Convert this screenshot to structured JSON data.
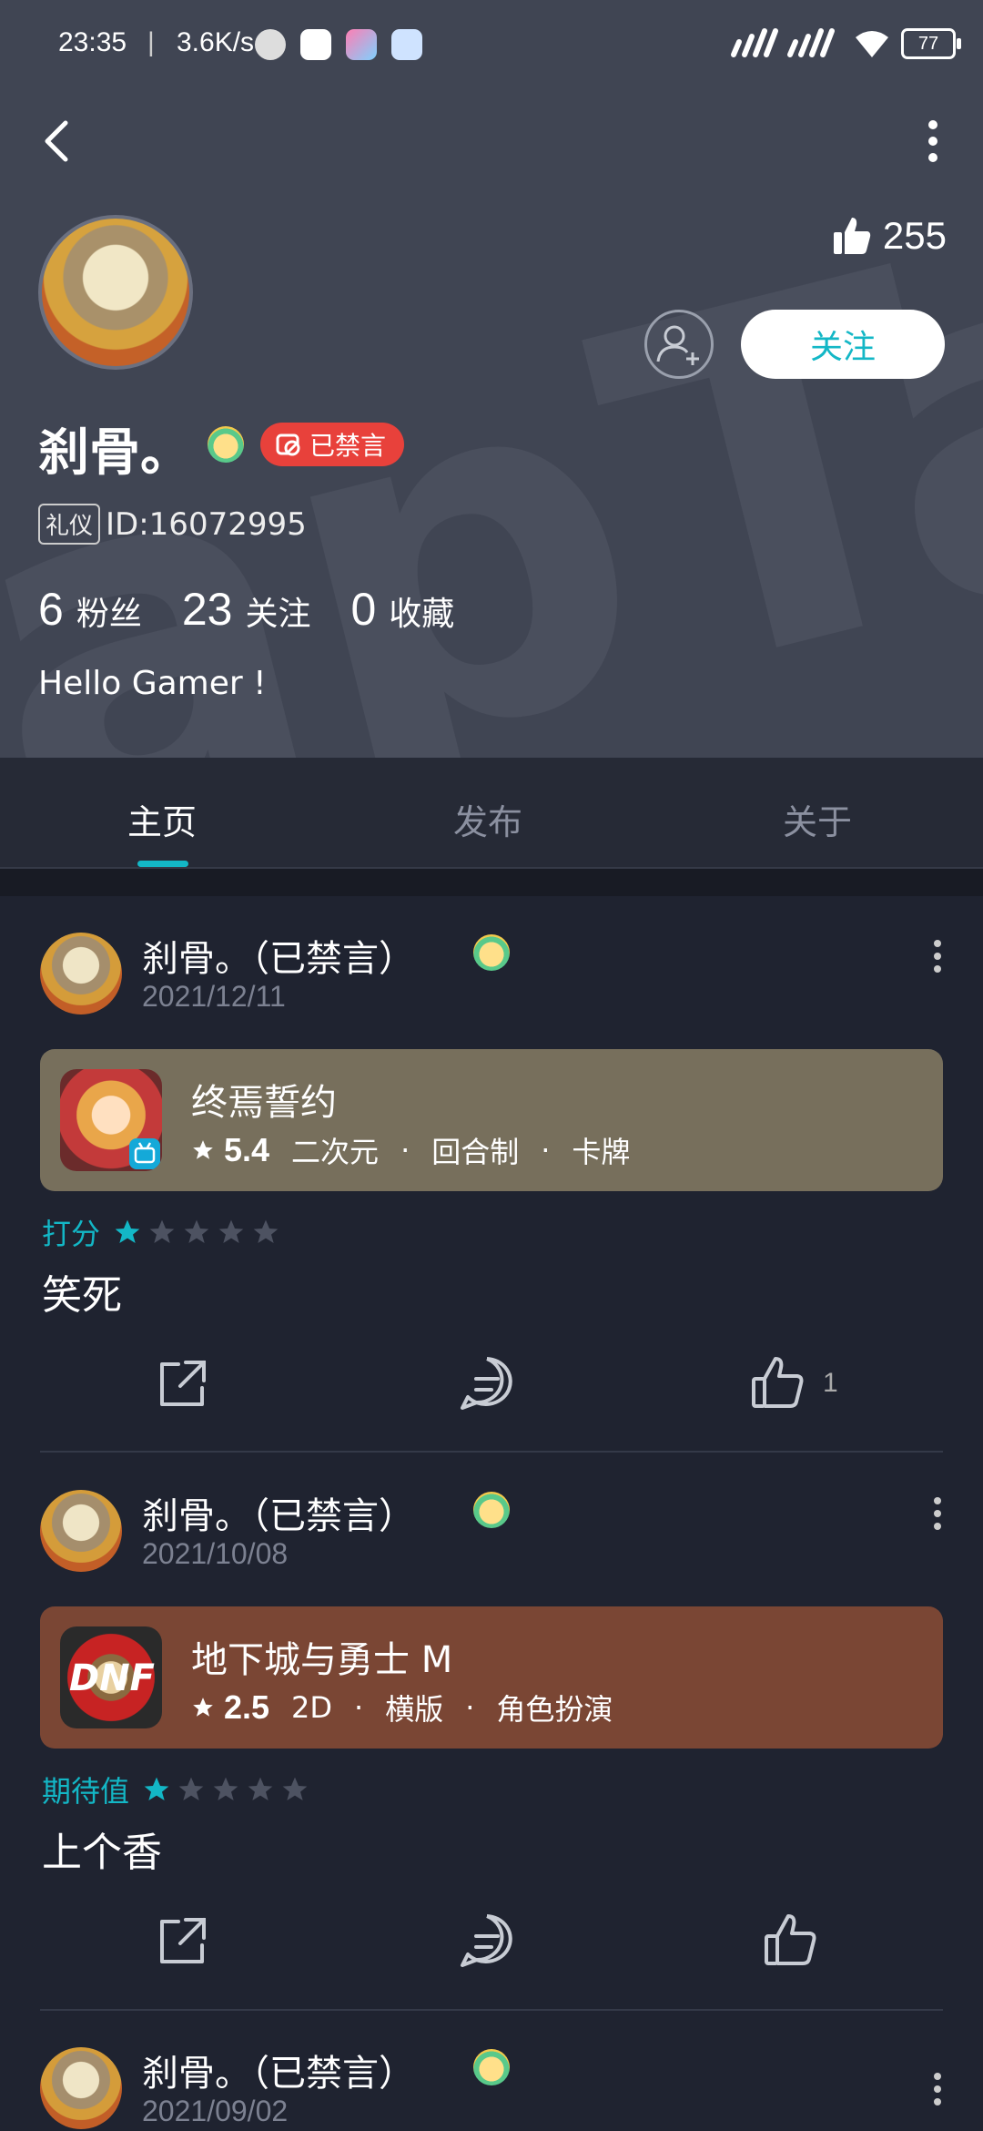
{
  "status_bar": {
    "time": "23:35",
    "separator": "|",
    "net_speed": "3.6K/s",
    "battery": "77"
  },
  "profile": {
    "likes": "255",
    "follow_label": "关注",
    "username": "刹骨。",
    "banned_label": "已禁言",
    "tag": "礼仪",
    "id": "ID:16072995",
    "stats": [
      {
        "num": "6",
        "label": "粉丝"
      },
      {
        "num": "23",
        "label": "关注"
      },
      {
        "num": "0",
        "label": "收藏"
      }
    ],
    "bio": "Hello Gamer !"
  },
  "tabs": [
    {
      "label": "主页"
    },
    {
      "label": "发布"
    },
    {
      "label": "关于"
    }
  ],
  "posts": [
    {
      "author": "刹骨。（已禁言）",
      "date": "2021/12/11",
      "game": {
        "name": "终焉誓约",
        "score": "5.4",
        "tags": [
          "二次元",
          "回合制",
          "卡牌"
        ],
        "card_color": "#776f5c"
      },
      "rating_label": "打分",
      "rating": 1,
      "text": "笑死",
      "like_count": "1"
    },
    {
      "author": "刹骨。（已禁言）",
      "date": "2021/10/08",
      "game": {
        "name": "地下城与勇士 M",
        "score": "2.5",
        "tags": [
          "2D",
          "横版",
          "角色扮演"
        ],
        "card_color": "#7a4634"
      },
      "rating_label": "期待值",
      "rating": 1,
      "text": "上个香",
      "like_count": ""
    },
    {
      "author": "刹骨。（已禁言）",
      "date": "2021/09/02"
    }
  ],
  "colors": {
    "accent": "#13b7c6",
    "banned": "#e8413b",
    "header_bg": "#404553",
    "page_bg": "#1f2330"
  }
}
